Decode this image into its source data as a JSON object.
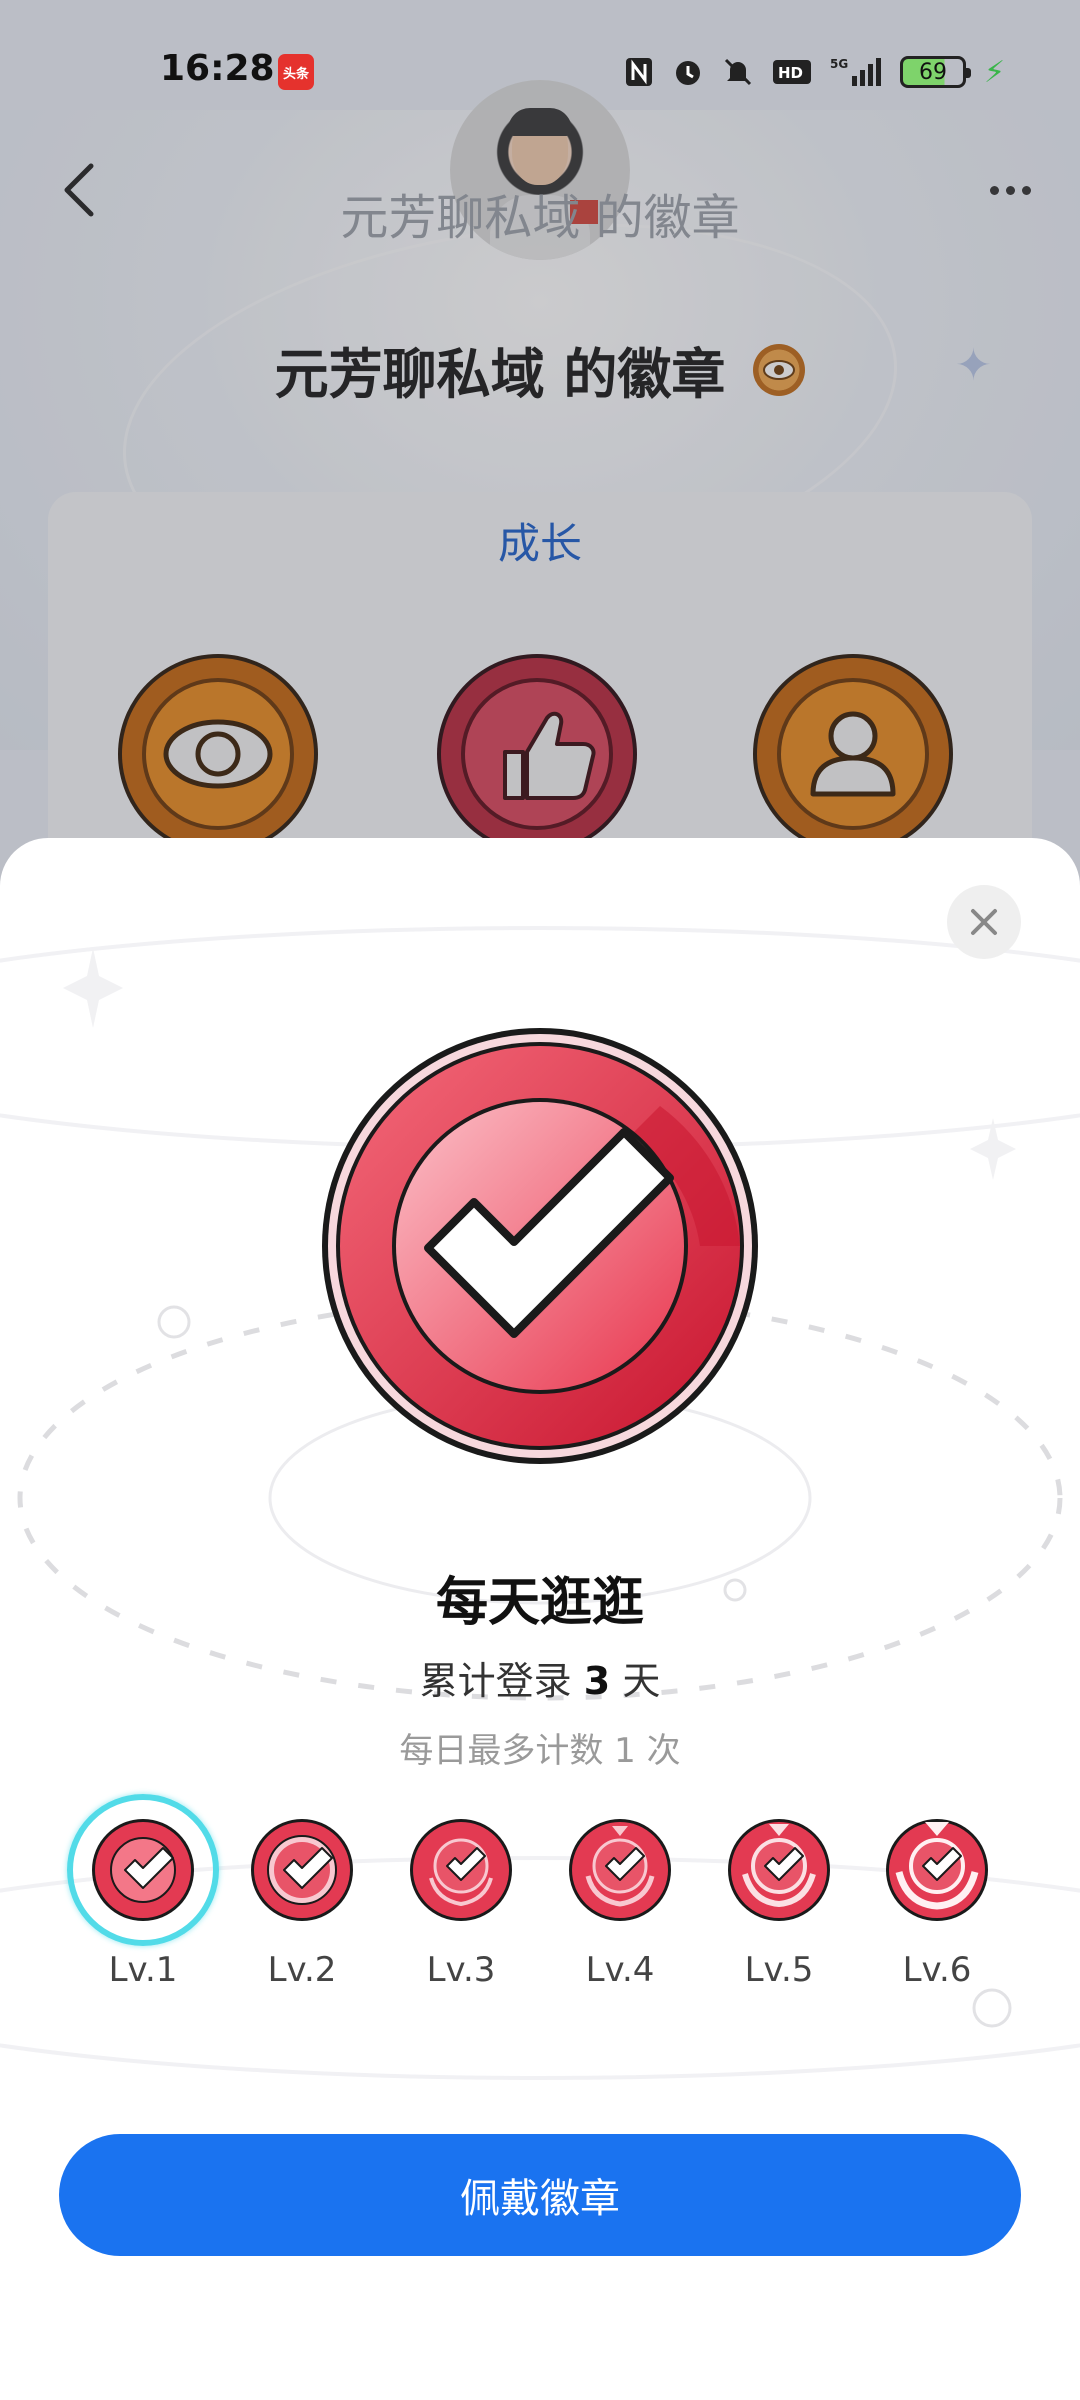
{
  "status_bar": {
    "time": "16:28",
    "app_chip": "头条",
    "icons": [
      "nfc-icon",
      "alarm-icon",
      "mute-icon",
      "hd-icon",
      "5g-signal-icon"
    ],
    "battery": "69"
  },
  "header": {
    "title": "元芳聊私域 的徽章",
    "back_icon": "chevron-left-icon",
    "more_icon": "more-icon"
  },
  "page": {
    "title": "元芳聊私域 的徽章",
    "section_title": "成长",
    "badges": [
      "eye-badge",
      "thumbs-up-badge",
      "person-badge"
    ]
  },
  "sheet": {
    "badge_name": "每天逛逛",
    "desc_prefix": "累计登录",
    "desc_count": "3",
    "desc_suffix": "天",
    "limit": "每日最多计数 1 次",
    "levels": [
      "Lv.1",
      "Lv.2",
      "Lv.3",
      "Lv.4",
      "Lv.5",
      "Lv.6"
    ],
    "selected_level": "Lv.1",
    "wear_button": "佩戴徽章"
  },
  "colors": {
    "accent": "#1a73f0",
    "badge_red": "#e8364e",
    "selected_ring": "#52dbe8",
    "section_blue": "#1c5fc9"
  }
}
